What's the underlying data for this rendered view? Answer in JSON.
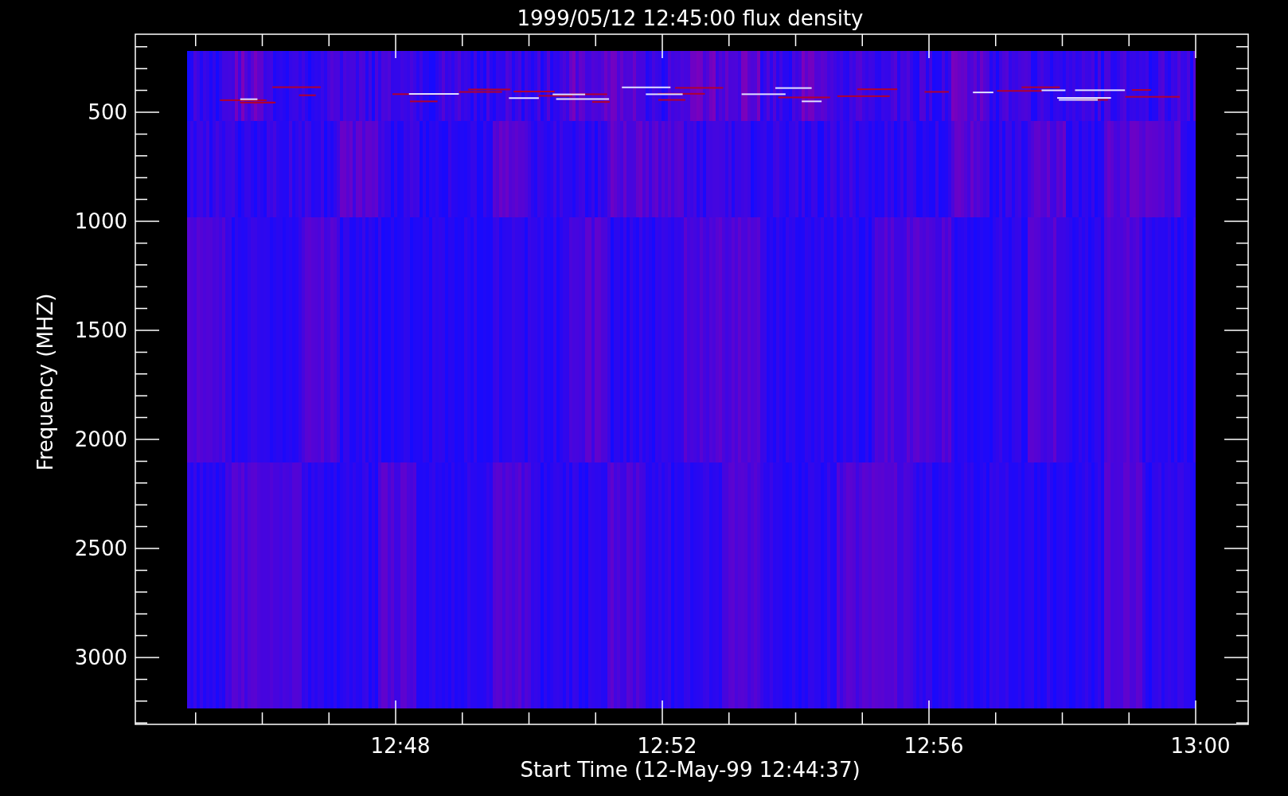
{
  "title": "1999/05/12 12:45:00 flux density",
  "y_axis": {
    "label": "Frequency (MHZ)",
    "ticks": [
      "500",
      "1000",
      "1500",
      "2000",
      "2500",
      "3000"
    ]
  },
  "x_axis": {
    "label": "Start Time (12-May-99 12:44:37)",
    "ticks": [
      "12:48",
      "12:52",
      "12:56",
      "13:00"
    ]
  }
}
